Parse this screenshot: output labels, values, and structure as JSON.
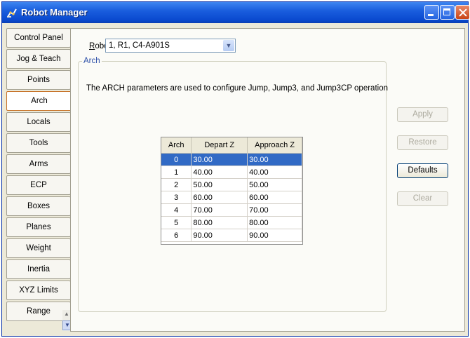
{
  "window": {
    "title": "Robot Manager"
  },
  "sidebar": {
    "items": [
      {
        "label": "Control Panel"
      },
      {
        "label": "Jog & Teach"
      },
      {
        "label": "Points"
      },
      {
        "label": "Arch",
        "active": true
      },
      {
        "label": "Locals"
      },
      {
        "label": "Tools"
      },
      {
        "label": "Arms"
      },
      {
        "label": "ECP"
      },
      {
        "label": "Boxes"
      },
      {
        "label": "Planes"
      },
      {
        "label": "Weight"
      },
      {
        "label": "Inertia"
      },
      {
        "label": "XYZ Limits"
      },
      {
        "label": "Range"
      }
    ]
  },
  "robot": {
    "label": "Robot:",
    "selected": "1, R1, C4-A901S"
  },
  "group": {
    "title": "Arch"
  },
  "description": "The ARCH parameters are used to configure Jump, Jump3, and Jump3CP operation",
  "table": {
    "headers": [
      "Arch",
      "Depart Z",
      "Approach Z"
    ],
    "rows": [
      [
        "0",
        "30.00",
        "30.00"
      ],
      [
        "1",
        "40.00",
        "40.00"
      ],
      [
        "2",
        "50.00",
        "50.00"
      ],
      [
        "3",
        "60.00",
        "60.00"
      ],
      [
        "4",
        "70.00",
        "70.00"
      ],
      [
        "5",
        "80.00",
        "80.00"
      ],
      [
        "6",
        "90.00",
        "90.00"
      ]
    ],
    "selected_row": 0
  },
  "buttons": {
    "apply": "Apply",
    "restore": "Restore",
    "defaults": "Defaults",
    "clear": "Clear"
  },
  "colors": {
    "titlebar": "#0a49cf",
    "selection": "#316ac5",
    "active_tab_border": "#c7742a"
  }
}
